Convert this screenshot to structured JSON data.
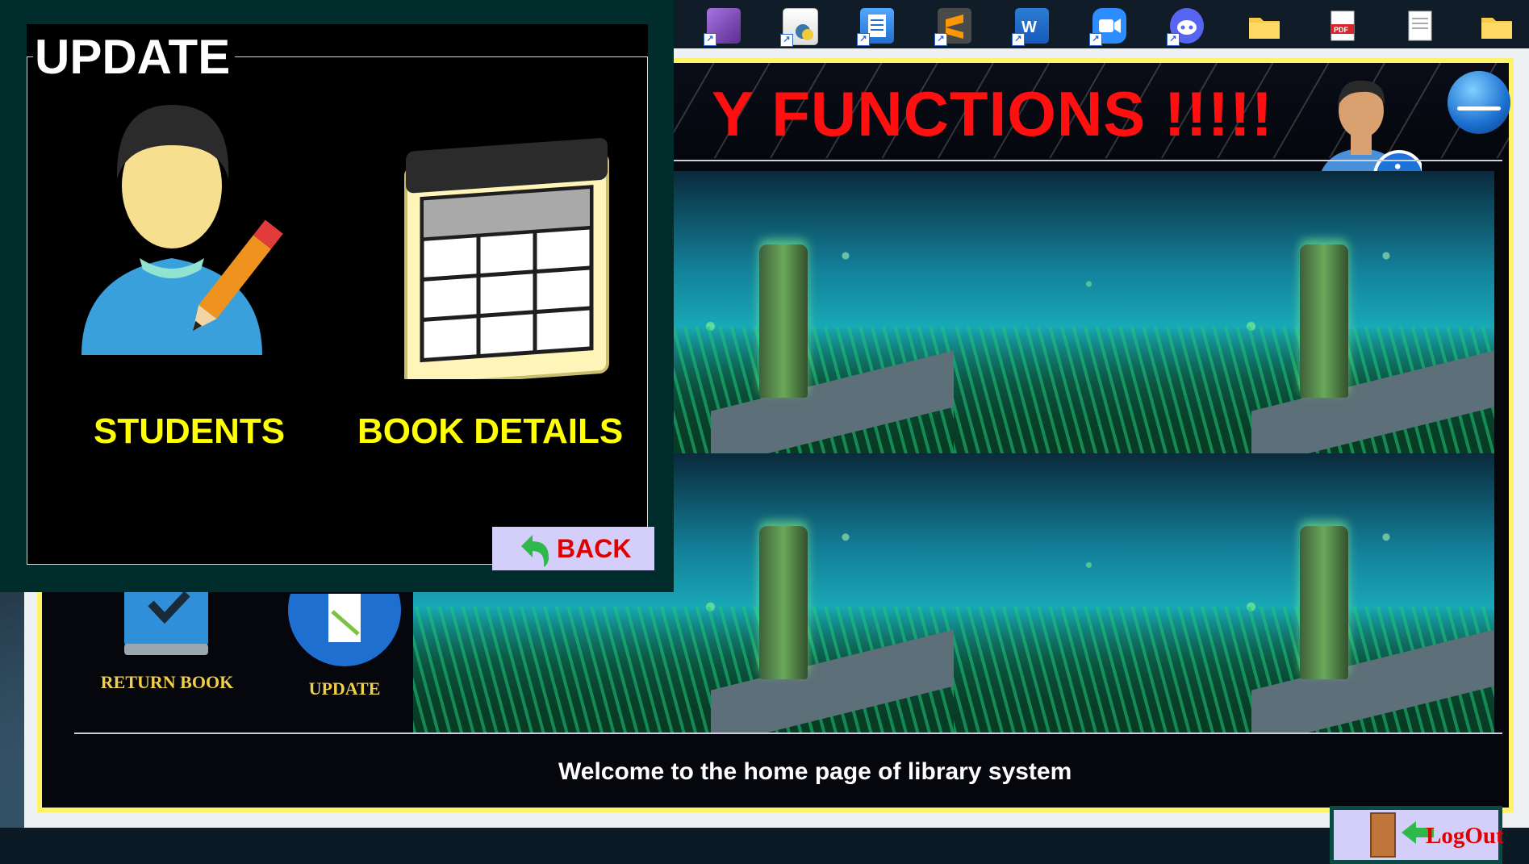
{
  "colors": {
    "accent_title": "#ff1010",
    "label_yellow": "#ffff00",
    "menu_gold": "#f2cf4a",
    "button_bg": "#d3cffa",
    "button_text": "#e00000",
    "frame_border": "#fff36a",
    "dialog_bg": "#002d2c"
  },
  "desktop": {
    "icons": [
      {
        "name": "visual-studio-icon"
      },
      {
        "name": "python-file-icon"
      },
      {
        "name": "notepad-icon"
      },
      {
        "name": "sublime-text-icon"
      },
      {
        "name": "word-icon"
      },
      {
        "name": "zoom-icon"
      },
      {
        "name": "discord-icon"
      },
      {
        "name": "folder-icon"
      },
      {
        "name": "pdf-file-icon"
      },
      {
        "name": "text-file-icon"
      },
      {
        "name": "folder-icon-2"
      }
    ]
  },
  "main_window": {
    "header_title": "Y FUNCTIONS !!!!!",
    "menu": [
      {
        "label": "RETURN BOOK",
        "icon": "return-book-icon"
      },
      {
        "label": "UPDATE",
        "icon": "update-notepad-icon"
      }
    ],
    "welcome_text": "Welcome to the home page of library system",
    "logout_label": "LogOut"
  },
  "dialog": {
    "title": "UPDATE",
    "options": [
      {
        "label": "STUDENTS",
        "icon": "student-edit-icon"
      },
      {
        "label": "BOOK DETAILS",
        "icon": "table-icon"
      }
    ],
    "back_label": "BACK"
  }
}
